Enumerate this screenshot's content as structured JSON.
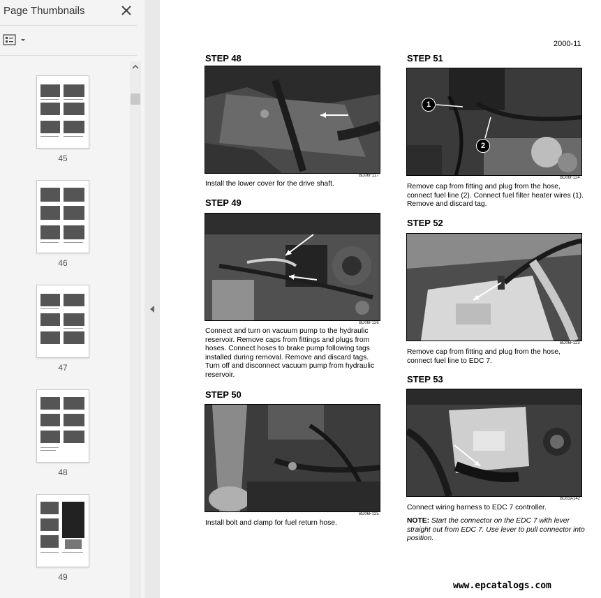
{
  "sidebar": {
    "title": "Page Thumbnails",
    "thumbnails": [
      {
        "label": "45"
      },
      {
        "label": "46"
      },
      {
        "label": "47"
      },
      {
        "label": "48"
      },
      {
        "label": "49"
      }
    ]
  },
  "page": {
    "page_number": "2000-11",
    "steps": [
      {
        "title": "STEP 48",
        "code": "BD06F127",
        "caption": "Install the lower cover for the drive shaft."
      },
      {
        "title": "STEP 49",
        "code": "BD06F126",
        "caption": "Connect and turn on vacuum pump to the hydraulic reservoir. Remove caps from fittings and plugs from hoses. Connect hoses to brake pump following tags installed during removal. Remove and discard tags. Turn off and disconnect vacuum pump from hydraulic reservoir."
      },
      {
        "title": "STEP 50",
        "code": "BD06F125",
        "caption": "Install bolt and clamp for fuel return hose."
      },
      {
        "title": "STEP 51",
        "code": "BD06F124",
        "caption": "Remove cap from fitting and plug from the hose, connect fuel line (2). Connect fuel filter heater wires (1). Remove and discard tag.",
        "callouts": [
          "1",
          "2"
        ]
      },
      {
        "title": "STEP 52",
        "code": "BD06F123",
        "caption": "Remove cap from fitting and plug from the hose, connect fuel line to EDC 7."
      },
      {
        "title": "STEP 53",
        "code": "BD03A142",
        "caption": "Connect wiring harness to EDC 7 controller.",
        "note_label": "NOTE:",
        "note_text": "Start the connector on the EDC 7 with lever straight out from EDC 7. Use lever to pull connector into position."
      }
    ],
    "watermark": "www.epcatalogs.com"
  }
}
